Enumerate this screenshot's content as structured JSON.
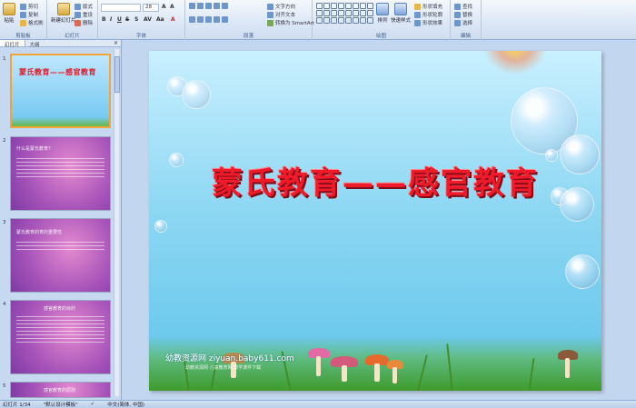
{
  "ribbon": {
    "clipboard": {
      "label": "剪贴板",
      "paste": "粘贴",
      "cut": "剪切",
      "copy": "复制",
      "format_painter": "格式刷"
    },
    "slides": {
      "label": "幻灯片",
      "new_slide": "新建幻灯片",
      "layout": "版式",
      "reset": "重设",
      "delete": "删除"
    },
    "font": {
      "label": "字体",
      "font_size": "28"
    },
    "paragraph": {
      "label": "段落",
      "text_direction": "文字方向",
      "align_text": "对齐文本",
      "smartart": "转换为 SmartArt"
    },
    "drawing": {
      "label": "绘图",
      "arrange": "排列",
      "quick_styles": "快速样式",
      "shape_fill": "形状填充",
      "shape_outline": "形状轮廓",
      "shape_effects": "形状效果"
    },
    "editing": {
      "label": "编辑",
      "find": "查找",
      "replace": "替换",
      "select": "选择"
    }
  },
  "pane": {
    "tab_slides": "幻灯片",
    "tab_outline": "大纲",
    "close": "×",
    "thumbnails": [
      {
        "num": "1",
        "title": "蒙氏教育——感官教育"
      },
      {
        "num": "2",
        "title": "什么是蒙氏教育?"
      },
      {
        "num": "3",
        "title": "蒙氏教育的育的重要性"
      },
      {
        "num": "4",
        "title": "感官教育的目的"
      },
      {
        "num": "5",
        "title": "感官教育的原则"
      }
    ]
  },
  "slide": {
    "title": "蒙氏教育——感官教育",
    "watermark": "幼教资源网 ziyuan.baby611.com",
    "watermark_sub": "幼教资源网 儿童教育网 教学课件下载"
  },
  "status": {
    "slide_info": "幻灯片 1/34",
    "theme": "\"默认设计模板\"",
    "language": "中文(简体, 中国)"
  }
}
